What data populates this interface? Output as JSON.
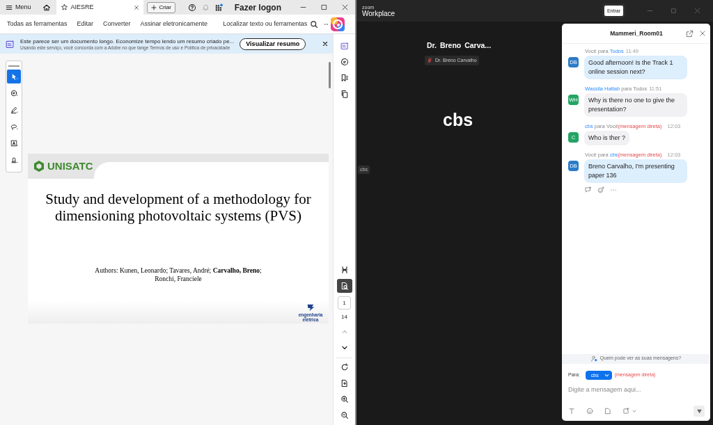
{
  "acrobat": {
    "menu_label": "Menu",
    "tab": {
      "title": "AIESRE"
    },
    "create_button": "Criar",
    "sign_in": "Fazer logon",
    "tools": [
      "Todas as ferramentas",
      "Editar",
      "Converter",
      "Assinar eletronicamente"
    ],
    "search_label": "Localizar texto ou ferramentas",
    "banner": {
      "text": "Este parece ser um documento longo. Economize tempo lendo um resumo criado pe...",
      "notice": "Usando este serviço, você concorda com a Adobe no que tange",
      "terms_link": "Termos de uso",
      "and_word": "e",
      "privacy_link": "Política de privacidade",
      "button": "Visualizar resumo"
    },
    "palette": [
      {
        "kind": "select",
        "selected": true
      },
      {
        "kind": "comment",
        "selected": false
      },
      {
        "kind": "draw",
        "selected": false
      },
      {
        "kind": "lasso",
        "selected": false
      },
      {
        "kind": "text-select",
        "selected": false
      },
      {
        "kind": "stamp",
        "selected": false
      }
    ],
    "document": {
      "logo": "UNISATC",
      "title": "Study and development of a methodology for dimensioning photovoltaic systems (PVS)",
      "authors": "Authors: Kunen, Leonardo; Tavares, André; **Carvalho, Breno**; Ronchi, Franciele",
      "footer_logo": "engenharia elétrica"
    },
    "page_nav": {
      "current": "1",
      "total": "14",
      "prev_disabled": true
    }
  },
  "zoom": {
    "brand_small": "zoom",
    "brand": "Workplace",
    "join_button": "Entrar",
    "speaker": {
      "name": "Dr. Breno Carva...",
      "tag": "Dr. Breno Carvalho",
      "muted": true
    },
    "participant": {
      "name": "cbs",
      "tag": "cbs"
    },
    "chat": {
      "title": "Mammeri_Room01",
      "messages": [
        {
          "sender": "Você",
          "to_word": "para",
          "recipient": "Todos",
          "time": "11:49",
          "avatar": "DB",
          "color": "#2b7bc8",
          "mine": true,
          "text": "Good afternoon! Is the Track 1 online session next?"
        },
        {
          "sender": "Wassila Hattab",
          "to_word": "para",
          "recipient": "Todos",
          "time": "11:51",
          "avatar": "WH",
          "color": "#22a565",
          "mine": false,
          "text": "Why is there no one to give the presentation?"
        },
        {
          "sender": "cbs",
          "to_word": "para",
          "recipient": "Você",
          "direct": "(mensagem direta)",
          "time": "12:03",
          "avatar": "C",
          "color": "#22a565",
          "mine": false,
          "text": "Who is ther ?"
        },
        {
          "sender": "Você",
          "to_word": "para",
          "recipient": "cbs",
          "direct": "(mensagem direta)",
          "time": "12:03",
          "avatar": "DB",
          "color": "#2b7bc8",
          "mine": true,
          "text": "Breno Carvalho, I'm presenting paper 136"
        }
      ],
      "privacy": "Quem pode ver as suas mensagens?",
      "to_label": "Para:",
      "recipient": "cbs",
      "direct_note": "(mensagem direta)",
      "placeholder": "Digite a mensagem aqui..."
    }
  }
}
